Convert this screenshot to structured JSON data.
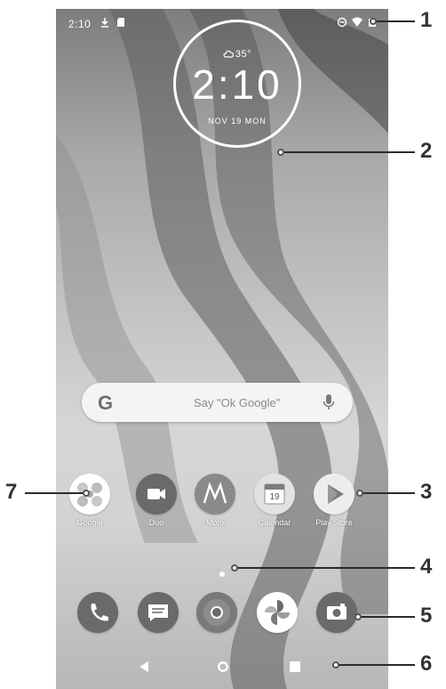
{
  "status_bar": {
    "time": "2:10",
    "icons": [
      "download-icon",
      "sd-card-icon",
      "do-not-disturb-icon",
      "wifi-icon",
      "battery-icon"
    ]
  },
  "clock_widget": {
    "weather": "35°",
    "weather_icon": "cloud-icon",
    "time": "2:10",
    "date": "NOV 19 MON"
  },
  "search_bar": {
    "logo": "G",
    "hint": "Say \"Ok Google\"",
    "mic_icon": "mic-icon"
  },
  "apps": [
    {
      "label": "Google",
      "icon": "google-folder-icon"
    },
    {
      "label": "Duo",
      "icon": "duo-icon"
    },
    {
      "label": "Moto",
      "icon": "moto-icon"
    },
    {
      "label": "Calendar",
      "icon": "calendar-icon",
      "badge": "19"
    },
    {
      "label": "Play Store",
      "icon": "play-store-icon"
    }
  ],
  "dock": [
    {
      "icon": "phone-icon"
    },
    {
      "icon": "messages-icon"
    },
    {
      "icon": "chrome-icon"
    },
    {
      "icon": "photos-icon"
    },
    {
      "icon": "camera-icon"
    }
  ],
  "nav": {
    "icons": [
      "back-icon",
      "home-icon",
      "recents-icon"
    ]
  },
  "callouts": [
    "1",
    "2",
    "3",
    "4",
    "5",
    "6",
    "7"
  ],
  "colors": {
    "callout_text": "#333333",
    "icon_bg": "#6f6f6f",
    "widget": "#ffffff"
  }
}
